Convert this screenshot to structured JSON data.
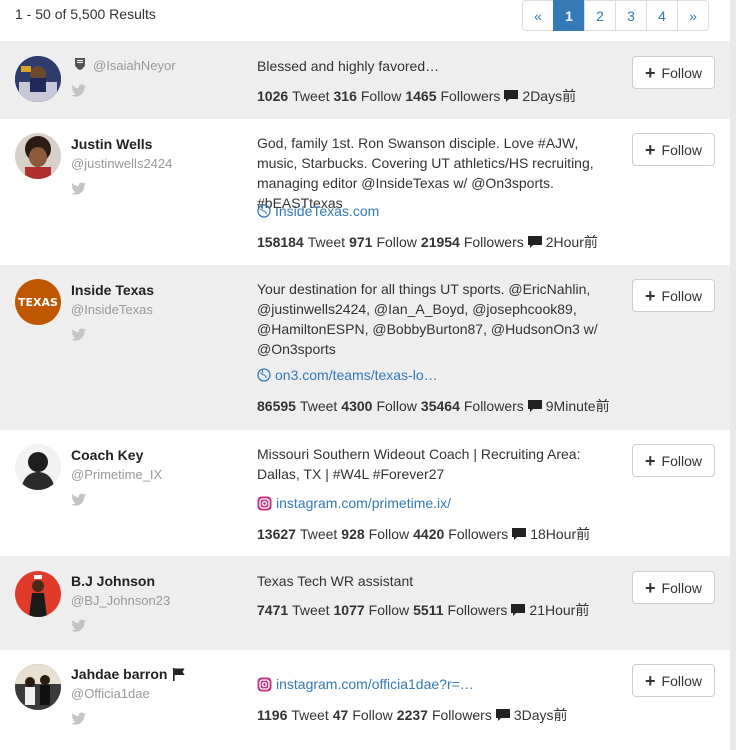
{
  "results": {
    "summary": "1 - 50 of 5,500 Results"
  },
  "pagination": {
    "prev": "«",
    "pages": [
      "1",
      "2",
      "3",
      "4"
    ],
    "active": "1",
    "next": "»"
  },
  "follow_label": "Follow",
  "tweet_label": "Tweet",
  "follow_count_label": "Follow",
  "followers_label": "Followers",
  "users": [
    {
      "name": "",
      "handle": "@IsaiahNeyor",
      "bio": "Blessed and highly favored…",
      "link": "",
      "tweets": "1026",
      "follows": "316",
      "followers": "1465",
      "last": "2Days前"
    },
    {
      "name": "Justin Wells",
      "handle": "@justinwells2424",
      "bio": "God, family 1st. Ron Swanson disciple. Love #AJW, music, Starbucks. Covering UT athletics/HS recruiting, managing editor @InsideTexas w/ @On3sports. #bEASTtexas",
      "link": "InsideTexas.com",
      "tweets": "158184",
      "follows": "971",
      "followers": "21954",
      "last": "2Hour前"
    },
    {
      "name": "Inside Texas",
      "handle": "@InsideTexas",
      "bio": "Your destination for all things UT sports. @EricNahlin, @justinwells2424, @Ian_A_Boyd, @josephcook89, @HamiltonESPN, @BobbyBurton87, @HudsonOn3 w/ @On3sports",
      "link": "on3.com/teams/texas-lo…",
      "tweets": "86595",
      "follows": "4300",
      "followers": "35464",
      "last": "9Minute前"
    },
    {
      "name": "Coach Key",
      "handle": "@Primetime_IX",
      "bio": "Missouri Southern Wideout Coach | Recruiting Area: Dallas, TX | #W4L #Forever27",
      "link": "instagram.com/primetime.ix/",
      "tweets": "13627",
      "follows": "928",
      "followers": "4420",
      "last": "18Hour前"
    },
    {
      "name": "B.J Johnson",
      "handle": "@BJ_Johnson23",
      "bio": "Texas Tech WR assistant",
      "link": "",
      "tweets": "7471",
      "follows": "1077",
      "followers": "5511",
      "last": "21Hour前"
    },
    {
      "name": "Jahdae barron",
      "handle": "@Officia1dae",
      "bio": "",
      "link": "instagram.com/officia1dae?r=…",
      "tweets": "1196",
      "follows": "47",
      "followers": "2237",
      "last": "3Days前"
    }
  ],
  "avatar_text": {
    "inside_texas": "TEXAS"
  },
  "colors": {
    "link": "#337ab7",
    "shade": "#eeeeee",
    "texas_orange": "#bf5700",
    "instagram": "#c13584"
  }
}
